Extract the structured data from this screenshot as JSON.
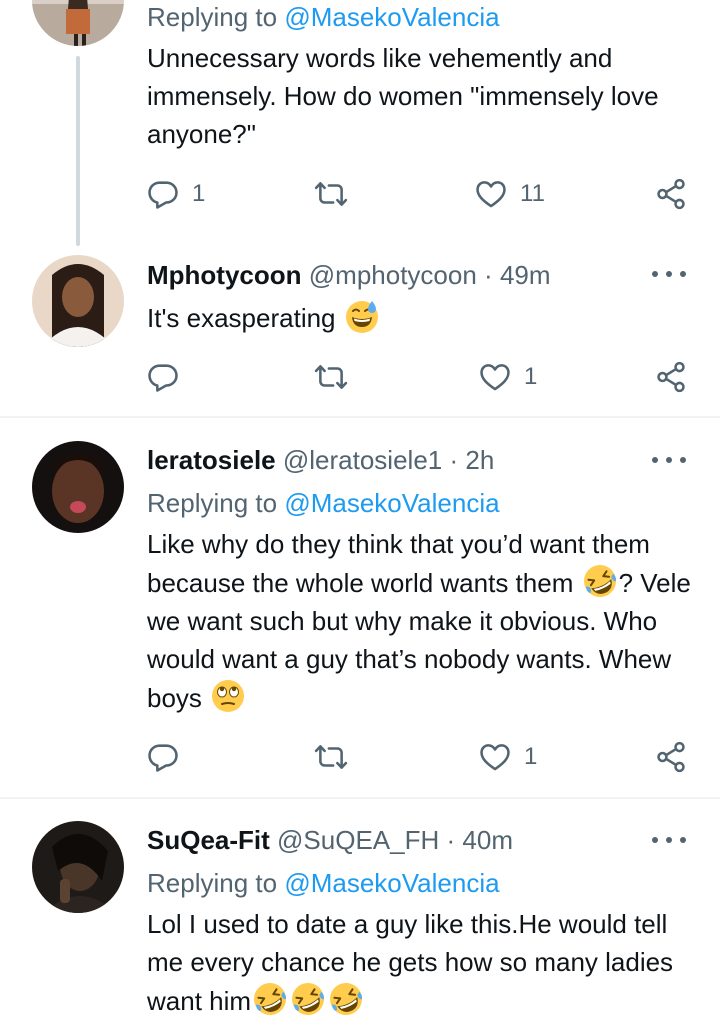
{
  "tweets": [
    {
      "replying_prefix": "Replying to",
      "replying_to": "@MasekoValencia",
      "text": "Unnecessary words like vehemently and immensely. How do women \"immensely love anyone?\"",
      "replies": "1",
      "retweets": "",
      "likes": "11"
    },
    {
      "name": "Mphotycoon",
      "handle": "@mphotycoon",
      "separator": "·",
      "time": "49m",
      "text": "It's exasperating",
      "replies": "",
      "retweets": "",
      "likes": "1"
    },
    {
      "name": "leratosiele",
      "handle": "@leratosiele1",
      "separator": "·",
      "time": "2h",
      "replying_prefix": "Replying to",
      "replying_to": "@MasekoValencia",
      "text_part1": "Like why do they think that you’d want them because the whole world wants them",
      "text_part2": "? Vele we want such but why make it obvious. Who would want a guy that’s nobody wants. Whew boys",
      "replies": "",
      "retweets": "",
      "likes": "1"
    },
    {
      "name": "SuQea-Fit",
      "handle": "@SuQEA_FH",
      "separator": "·",
      "time": "40m",
      "replying_prefix": "Replying to",
      "replying_to": "@MasekoValencia",
      "text": "Lol I used to date a guy like this.He would tell me every chance he gets how so many ladies want him"
    }
  ],
  "icons": {
    "reply": "reply-icon",
    "retweet": "retweet-icon",
    "like": "heart-icon",
    "share": "share-icon",
    "more": "more-options-icon",
    "emoji_sweat": "grinning-sweat-emoji",
    "emoji_rofl": "rolling-laughing-emoji",
    "emoji_eyeroll": "eye-roll-emoji"
  },
  "colors": {
    "mention": "#1d9bf0",
    "secondary_text": "#536471",
    "divider": "#eff3f4",
    "thread_line": "#cfd9de"
  }
}
